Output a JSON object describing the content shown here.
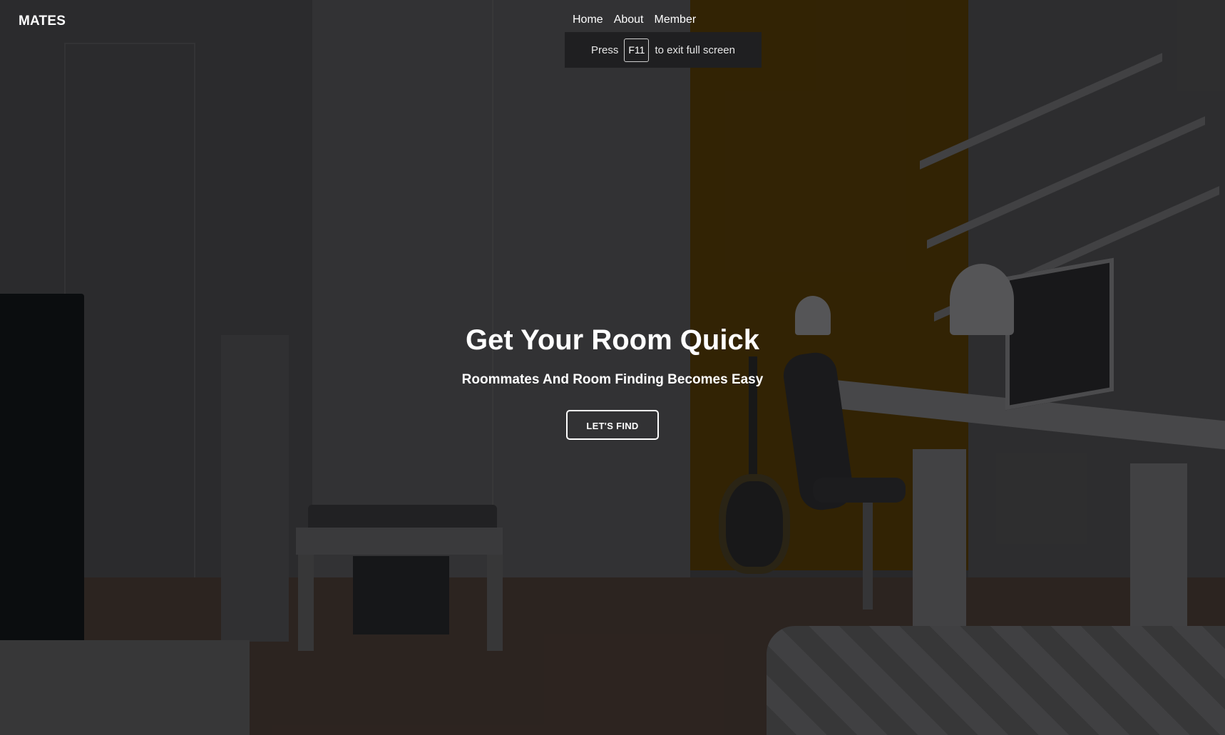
{
  "brand": {
    "name": "MATES"
  },
  "nav": {
    "items": [
      {
        "label": "Home"
      },
      {
        "label": "About"
      },
      {
        "label": "Member"
      }
    ]
  },
  "fullscreen_hint": {
    "prefix": "Press",
    "key": "F11",
    "suffix": "to exit full screen"
  },
  "hero": {
    "title": "Get Your Room Quick",
    "subtitle": "Roommates And Room Finding Becomes Easy",
    "cta_label": "LET'S FIND"
  },
  "colors": {
    "text": "#ffffff",
    "background_overlay": "#2b2b2d",
    "accent_wall": "#352505"
  }
}
